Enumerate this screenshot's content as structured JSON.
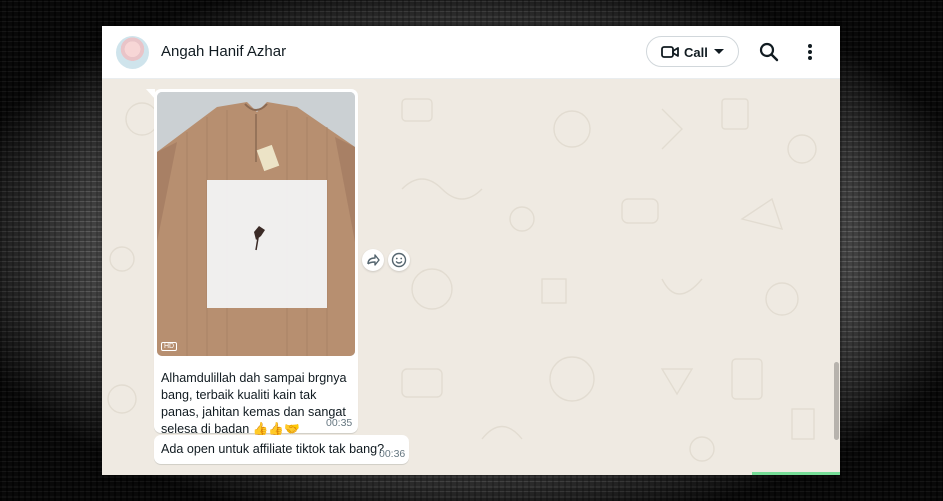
{
  "header": {
    "contact_name": "Angah Hanif Azhar",
    "call_label": "Call"
  },
  "messages": [
    {
      "type": "image",
      "badge": "HD",
      "caption": "Alhamdulillah dah sampai brgnya bang, terbaik kualiti kain tak panas, jahitan kemas dan sangat selesa di badan 👍👍🤝",
      "time": "00:35"
    },
    {
      "type": "text",
      "text": "Ada open untuk affiliate tiktok tak bang?",
      "time": "00:36"
    }
  ],
  "icons": {
    "forward": "forward-icon",
    "emoji": "emoji-reaction-icon",
    "video": "video-call-icon",
    "search": "search-icon",
    "menu": "more-vertical-icon"
  },
  "colors": {
    "chat_background": "#efeae2",
    "bubble": "#ffffff",
    "timestamp": "#667781",
    "shirt": "#b78f70"
  }
}
